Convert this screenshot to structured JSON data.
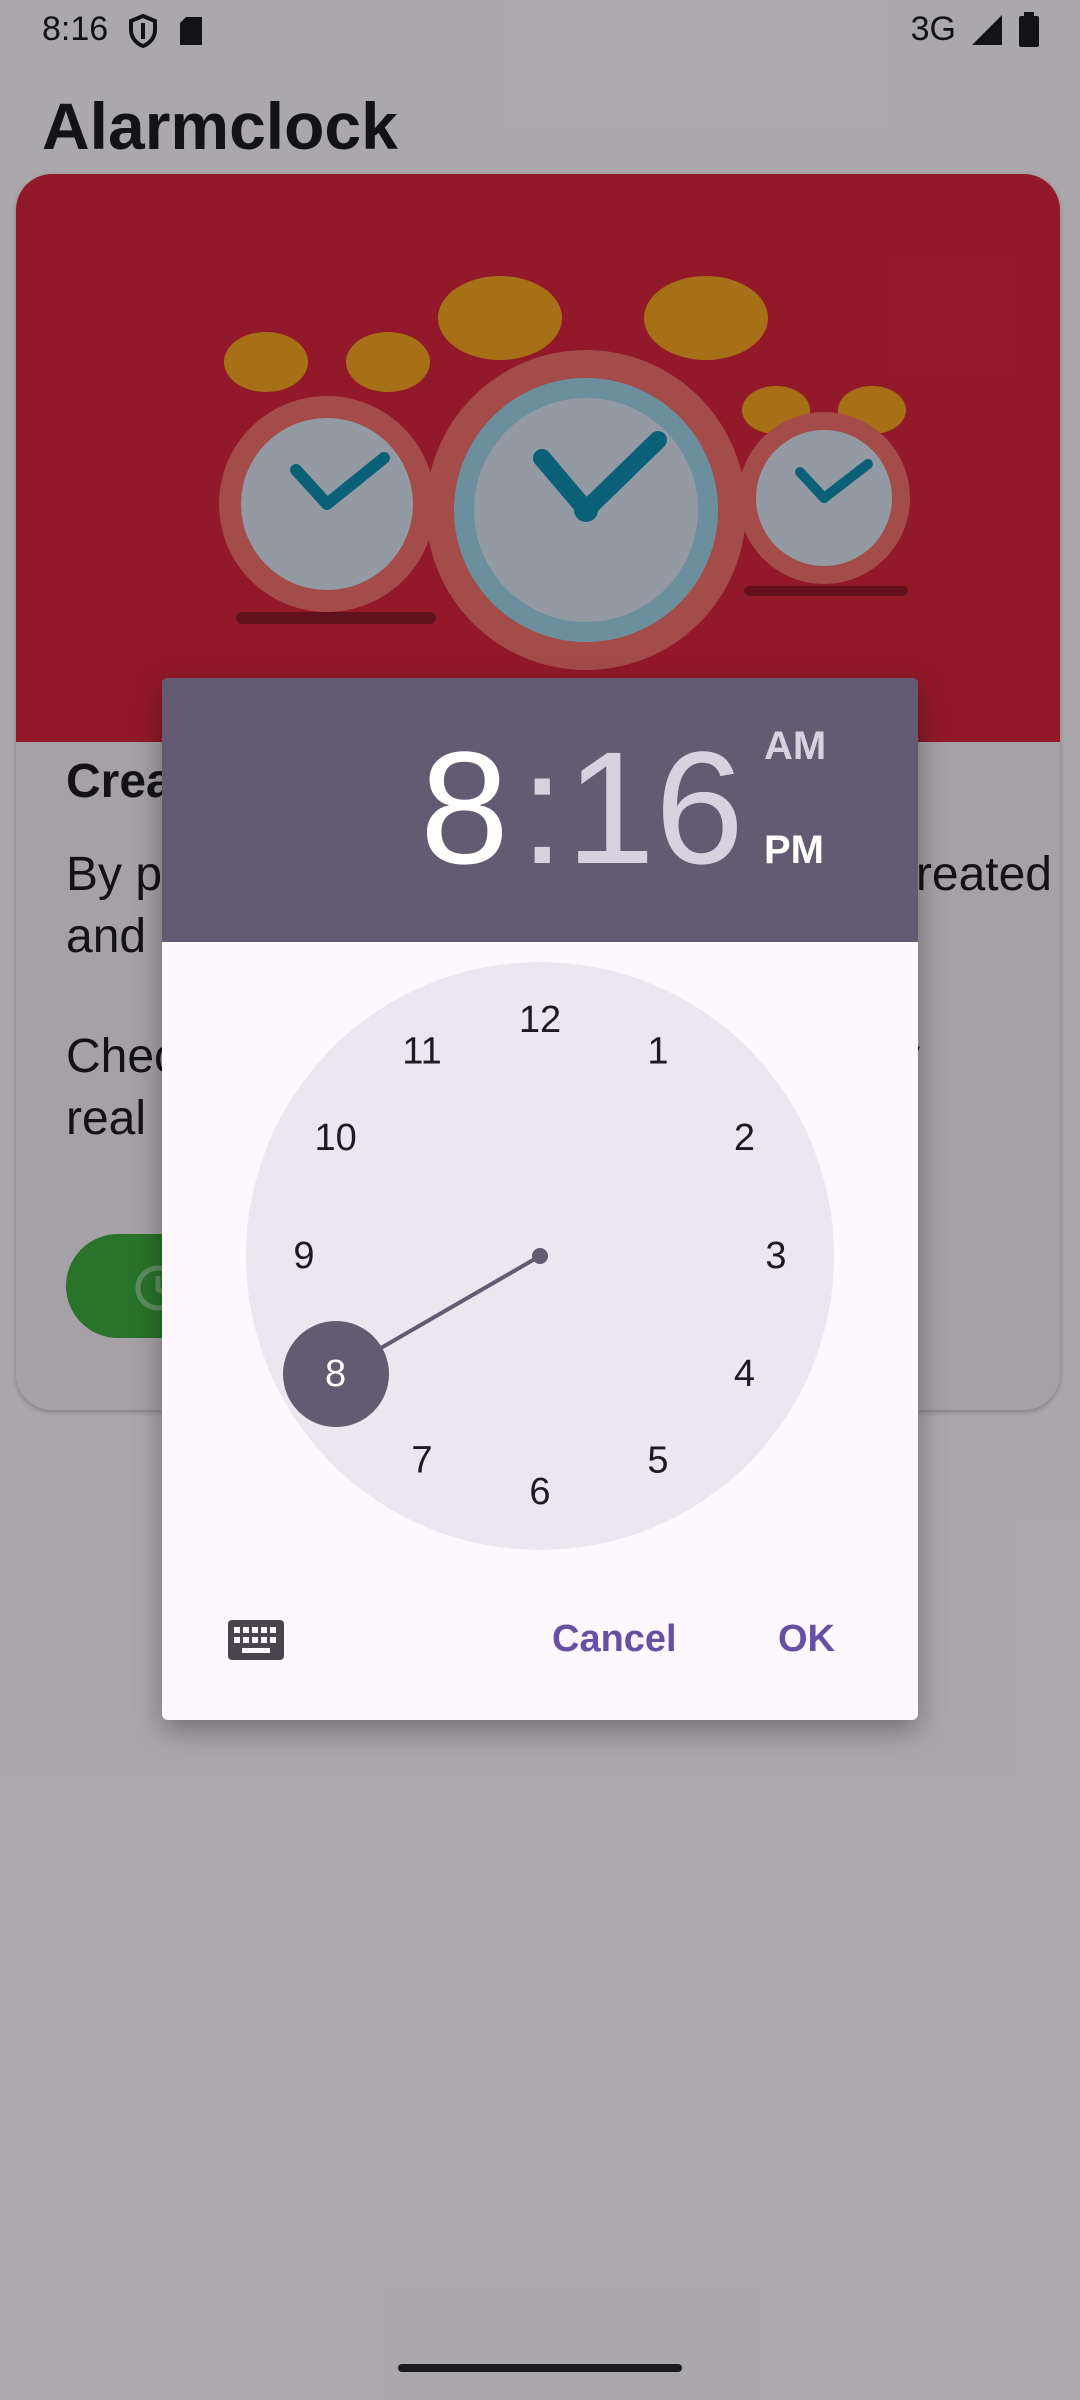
{
  "status_bar": {
    "time": "8:16",
    "network": "3G",
    "icons": [
      "shield-icon",
      "sd-card-icon",
      "signal-icon",
      "battery-icon"
    ]
  },
  "app": {
    "title": "Alarmclock"
  },
  "card": {
    "title_visible": "Crea",
    "line1_left": "By p",
    "line1_right": "reated",
    "line2_left": "and",
    "line3_left": "Chec",
    "line3_right": "y",
    "line4_left": "real",
    "button_icon": "alarm-icon",
    "hero_color": "#D7263D",
    "button_color": "#3DAA3F"
  },
  "time_picker": {
    "hour": "8",
    "separator": ":",
    "minute": "16",
    "am_label": "AM",
    "pm_label": "PM",
    "selected_period": "PM",
    "selected_hour": "8",
    "dial_numbers": [
      "12",
      "1",
      "2",
      "3",
      "4",
      "5",
      "6",
      "7",
      "8",
      "9",
      "10",
      "11"
    ],
    "keyboard_icon": "keyboard-icon",
    "cancel_label": "Cancel",
    "ok_label": "OK",
    "header_color": "#625B71",
    "accent_color": "#6750A4"
  }
}
